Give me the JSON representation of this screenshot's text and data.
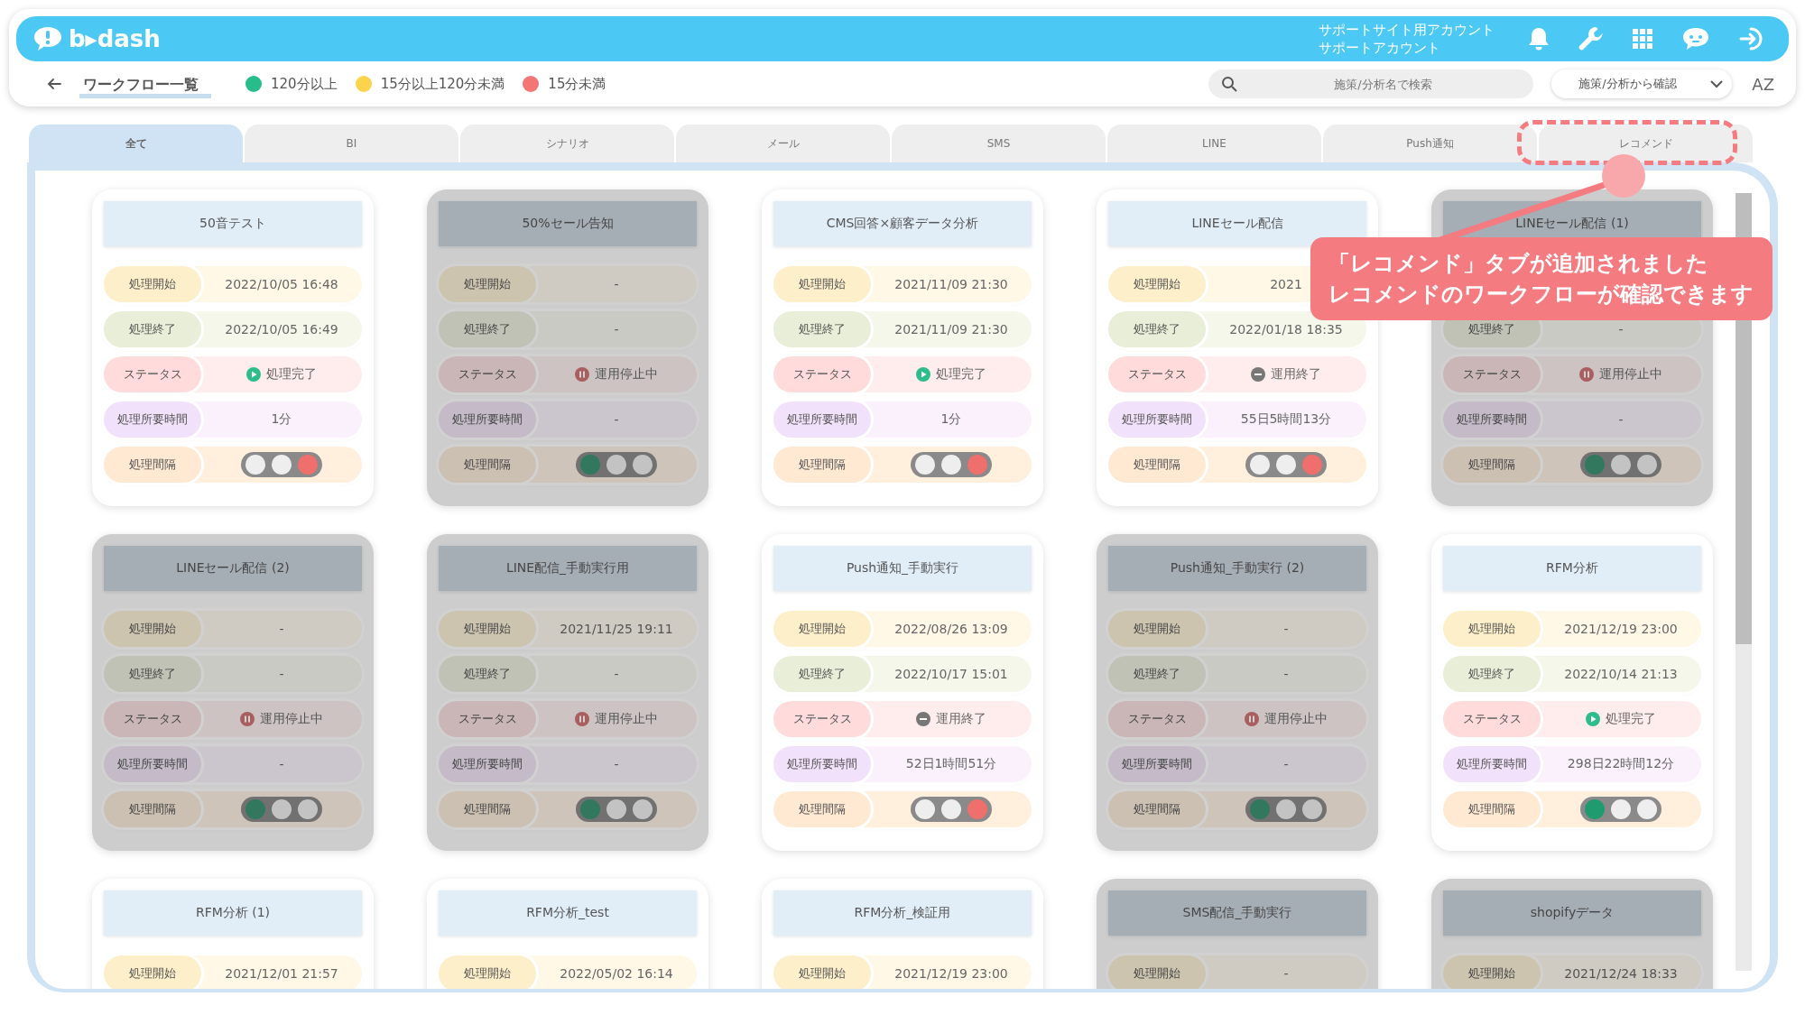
{
  "header": {
    "logo": "b▸dash",
    "account_lines": [
      "サポートサイト用アカウント",
      "サポートアカウント"
    ]
  },
  "toolbar": {
    "title": "ワークフロー一覧",
    "legend": [
      {
        "label": "120分以上",
        "color": "#27bd8b"
      },
      {
        "label": "15分以上120分未満",
        "color": "#fcd34d"
      },
      {
        "label": "15分未満",
        "color": "#f37575"
      }
    ],
    "search": {
      "placeholder": "施策/分析名で検索"
    },
    "filter": {
      "value": "施策/分析から確認"
    },
    "sort_label": "AZ"
  },
  "tabs": [
    {
      "label": "全て",
      "selected": true
    },
    {
      "label": "BI",
      "selected": false
    },
    {
      "label": "シナリオ",
      "selected": false
    },
    {
      "label": "メール",
      "selected": false
    },
    {
      "label": "SMS",
      "selected": false
    },
    {
      "label": "LINE",
      "selected": false
    },
    {
      "label": "Push通知",
      "selected": false
    },
    {
      "label": "レコメンド",
      "selected": false
    }
  ],
  "cards": [
    {
      "title": "50音テスト",
      "disabled": false,
      "rows": [
        {
          "kind": "text",
          "label": "処理開始",
          "value": "2022/10/05 16:48"
        },
        {
          "kind": "text",
          "label": "処理終了",
          "value": "2022/10/05 16:49"
        },
        {
          "kind": "done",
          "label": "ステータス",
          "value": "処理完了"
        },
        {
          "kind": "text",
          "label": "処理所要時間",
          "value": "1分"
        },
        {
          "kind": "light",
          "label": "処理間隔",
          "lamps": [
            {
              "on": false
            },
            {
              "on": false
            },
            {
              "on": true
            }
          ]
        }
      ]
    },
    {
      "title": "50%セール告知",
      "disabled": true,
      "rows": [
        {
          "kind": "text",
          "label": "処理開始",
          "value": "-"
        },
        {
          "kind": "text",
          "label": "処理終了",
          "value": "-"
        },
        {
          "kind": "stopped",
          "label": "ステータス",
          "value": "運用停止中"
        },
        {
          "kind": "text",
          "label": "処理所要時間",
          "value": "-"
        },
        {
          "kind": "light",
          "label": "処理間隔",
          "lamps": [
            {
              "on": true
            },
            {
              "on": false
            },
            {
              "on": false
            }
          ]
        }
      ]
    },
    {
      "title": "CMS回答×顧客データ分析",
      "disabled": false,
      "rows": [
        {
          "kind": "text",
          "label": "処理開始",
          "value": "2021/11/09 21:30"
        },
        {
          "kind": "text",
          "label": "処理終了",
          "value": "2021/11/09 21:30"
        },
        {
          "kind": "done",
          "label": "ステータス",
          "value": "処理完了"
        },
        {
          "kind": "text",
          "label": "処理所要時間",
          "value": "1分"
        },
        {
          "kind": "light",
          "label": "処理間隔",
          "lamps": [
            {
              "on": false
            },
            {
              "on": false
            },
            {
              "on": true
            }
          ]
        }
      ]
    },
    {
      "title": "LINEセール配信",
      "disabled": false,
      "rows": [
        {
          "kind": "text",
          "label": "処理開始",
          "value": "2021"
        },
        {
          "kind": "text",
          "label": "処理終了",
          "value": "2022/01/18 18:35"
        },
        {
          "kind": "ended",
          "label": "ステータス",
          "value": "運用終了"
        },
        {
          "kind": "text",
          "label": "処理所要時間",
          "value": "55日5時間13分"
        },
        {
          "kind": "light",
          "label": "処理間隔",
          "lamps": [
            {
              "on": false
            },
            {
              "on": false
            },
            {
              "on": true
            }
          ]
        }
      ]
    },
    {
      "title": "LINEセール配信 (1)",
      "disabled": true,
      "rows": [
        {
          "kind": "covered"
        },
        {
          "kind": "text",
          "label": "処理終了",
          "value": "-"
        },
        {
          "kind": "stopped",
          "label": "ステータス",
          "value": "運用停止中"
        },
        {
          "kind": "text",
          "label": "処理所要時間",
          "value": "-"
        },
        {
          "kind": "light",
          "label": "処理間隔",
          "lamps": [
            {
              "on": true
            },
            {
              "on": false
            },
            {
              "on": false
            }
          ]
        }
      ]
    },
    {
      "title": "LINEセール配信 (2)",
      "disabled": true,
      "rows": [
        {
          "kind": "text",
          "label": "処理開始",
          "value": "-"
        },
        {
          "kind": "text",
          "label": "処理終了",
          "value": "-"
        },
        {
          "kind": "stopped",
          "label": "ステータス",
          "value": "運用停止中"
        },
        {
          "kind": "text",
          "label": "処理所要時間",
          "value": "-"
        },
        {
          "kind": "light",
          "label": "処理間隔",
          "lamps": [
            {
              "on": true
            },
            {
              "on": false
            },
            {
              "on": false
            }
          ]
        }
      ]
    },
    {
      "title": "LINE配信_手動実行用",
      "disabled": true,
      "rows": [
        {
          "kind": "text",
          "label": "処理開始",
          "value": "2021/11/25 19:11"
        },
        {
          "kind": "text",
          "label": "処理終了",
          "value": "-"
        },
        {
          "kind": "stopped",
          "label": "ステータス",
          "value": "運用停止中"
        },
        {
          "kind": "text",
          "label": "処理所要時間",
          "value": "-"
        },
        {
          "kind": "light",
          "label": "処理間隔",
          "lamps": [
            {
              "on": true
            },
            {
              "on": false
            },
            {
              "on": false
            }
          ]
        }
      ]
    },
    {
      "title": "Push通知_手動実行",
      "disabled": false,
      "rows": [
        {
          "kind": "text",
          "label": "処理開始",
          "value": "2022/08/26 13:09"
        },
        {
          "kind": "text",
          "label": "処理終了",
          "value": "2022/10/17 15:01"
        },
        {
          "kind": "ended",
          "label": "ステータス",
          "value": "運用終了"
        },
        {
          "kind": "text",
          "label": "処理所要時間",
          "value": "52日1時間51分"
        },
        {
          "kind": "light",
          "label": "処理間隔",
          "lamps": [
            {
              "on": false
            },
            {
              "on": false
            },
            {
              "on": true
            }
          ]
        }
      ]
    },
    {
      "title": "Push通知_手動実行 (2)",
      "disabled": true,
      "rows": [
        {
          "kind": "text",
          "label": "処理開始",
          "value": "-"
        },
        {
          "kind": "text",
          "label": "処理終了",
          "value": "-"
        },
        {
          "kind": "stopped",
          "label": "ステータス",
          "value": "運用停止中"
        },
        {
          "kind": "text",
          "label": "処理所要時間",
          "value": "-"
        },
        {
          "kind": "light",
          "label": "処理間隔",
          "lamps": [
            {
              "on": true
            },
            {
              "on": false
            },
            {
              "on": false
            }
          ]
        }
      ]
    },
    {
      "title": "RFM分析",
      "disabled": false,
      "rows": [
        {
          "kind": "text",
          "label": "処理開始",
          "value": "2021/12/19 23:00"
        },
        {
          "kind": "text",
          "label": "処理終了",
          "value": "2022/10/14 21:13"
        },
        {
          "kind": "done",
          "label": "ステータス",
          "value": "処理完了"
        },
        {
          "kind": "text",
          "label": "処理所要時間",
          "value": "298日22時間12分"
        },
        {
          "kind": "light",
          "label": "処理間隔",
          "lamps": [
            {
              "on": true
            },
            {
              "on": false
            },
            {
              "on": false
            }
          ]
        }
      ]
    },
    {
      "title": "RFM分析 (1)",
      "disabled": false,
      "rows": [
        {
          "kind": "text",
          "label": "処理開始",
          "value": "2021/12/01 21:57"
        }
      ]
    },
    {
      "title": "RFM分析_test",
      "disabled": false,
      "rows": [
        {
          "kind": "text",
          "label": "処理開始",
          "value": "2022/05/02 16:14"
        }
      ]
    },
    {
      "title": "RFM分析_検証用",
      "disabled": false,
      "rows": [
        {
          "kind": "text",
          "label": "処理開始",
          "value": "2021/12/19 23:00"
        }
      ]
    },
    {
      "title": "SMS配信_手動実行",
      "disabled": true,
      "rows": [
        {
          "kind": "text",
          "label": "処理開始",
          "value": "-"
        }
      ]
    },
    {
      "title": "shopifyデータ",
      "disabled": true,
      "rows": [
        {
          "kind": "text",
          "label": "処理開始",
          "value": "2021/12/24 18:33"
        }
      ]
    }
  ],
  "callout": {
    "lines": [
      "「レコメンド」タブが追加されました",
      "レコメンドのワークフローが確認できます"
    ]
  }
}
